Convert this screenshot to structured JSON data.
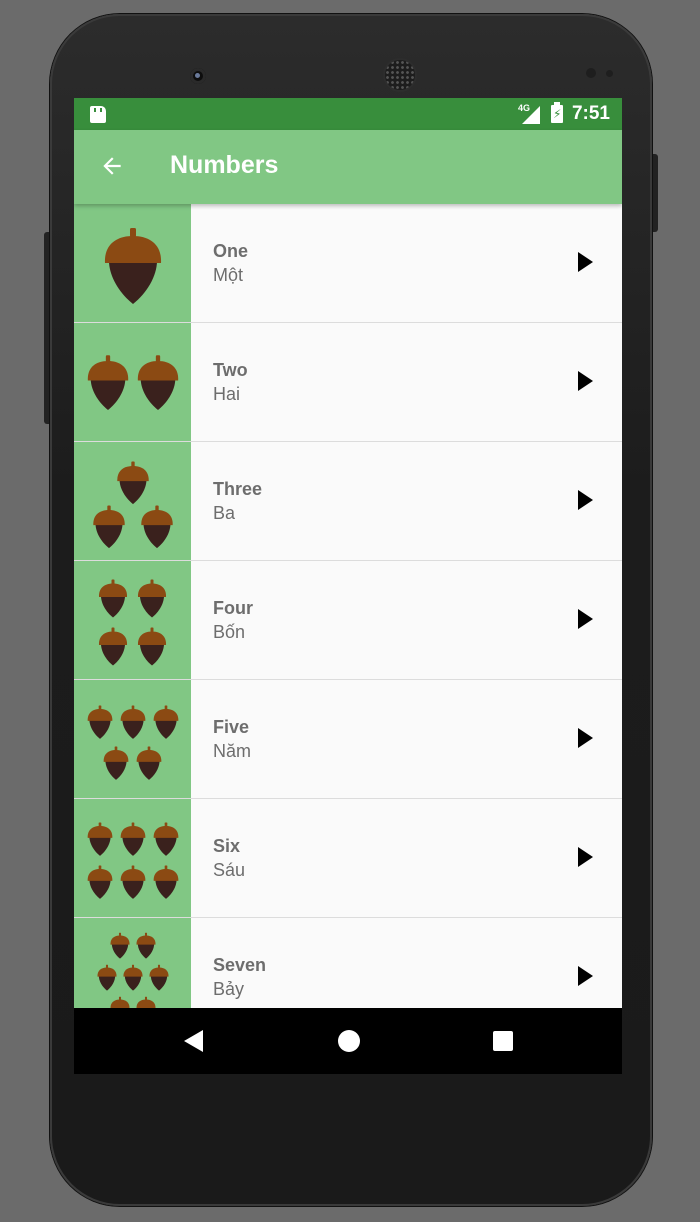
{
  "status_bar": {
    "network": "4G",
    "time": "7:51",
    "icons": [
      "sd-card-icon",
      "signal-icon",
      "battery-charging-icon"
    ]
  },
  "app_bar": {
    "title": "Numbers",
    "back_icon": "arrow-back-icon"
  },
  "colors": {
    "status_bar": "#388e3c",
    "app_bar": "#81c784",
    "tile_background": "#81c784",
    "acorn_cap": "#8b4a13",
    "acorn_body": "#3a211d",
    "text": "#6d6d6d"
  },
  "items": [
    {
      "english": "One",
      "vietnamese": "Một",
      "count": 1
    },
    {
      "english": "Two",
      "vietnamese": "Hai",
      "count": 2
    },
    {
      "english": "Three",
      "vietnamese": "Ba",
      "count": 3
    },
    {
      "english": "Four",
      "vietnamese": "Bốn",
      "count": 4
    },
    {
      "english": "Five",
      "vietnamese": "Năm",
      "count": 5
    },
    {
      "english": "Six",
      "vietnamese": "Sáu",
      "count": 6
    },
    {
      "english": "Seven",
      "vietnamese": "Bảy",
      "count": 7
    }
  ],
  "nav_bar": {
    "icons": [
      "nav-back-icon",
      "nav-home-icon",
      "nav-recents-icon"
    ]
  }
}
